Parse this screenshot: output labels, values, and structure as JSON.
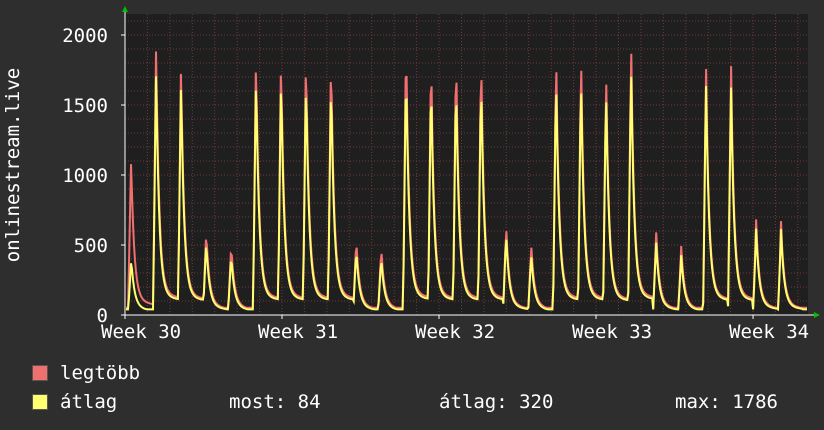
{
  "colors": {
    "background": "#2e2e2e",
    "plot_background": "#1f1f1f",
    "grid": "#6e3a3a",
    "text": "#ffffff",
    "axis": "#ffffff",
    "arrow": "#00c000",
    "max_color": "#f07070",
    "avg_color": "#ffff70"
  },
  "chart_data": {
    "type": "area",
    "ylabel": "onlinestream.live",
    "y_ticks": [
      "0",
      "500",
      "1000",
      "1500",
      "2000"
    ],
    "ylim": [
      0,
      2150
    ],
    "x_ticks": [
      "Week 30",
      "Week 31",
      "Week 32",
      "Week 33",
      "Week 34"
    ],
    "grid": true,
    "series": [
      {
        "name": "legtöbb",
        "color": "#f07070",
        "values": [
          1080,
          1910,
          1770,
          560,
          460,
          1850,
          1850,
          1860,
          1850,
          500,
          440,
          1960,
          1850,
          1860,
          1860,
          600,
          460,
          1860,
          1850,
          1720,
          1940,
          550,
          440,
          1760,
          1760,
          620,
          600
        ]
      },
      {
        "name": "átlag",
        "color": "#ffff70",
        "values": [
          370,
          1730,
          1650,
          500,
          400,
          1710,
          1710,
          1700,
          1690,
          440,
          380,
          1780,
          1700,
          1690,
          1700,
          550,
          400,
          1700,
          1690,
          1600,
          1780,
          490,
          390,
          1650,
          1620,
          570,
          560
        ]
      }
    ]
  },
  "legend": [
    {
      "label": "legtöbb",
      "color": "#f07070"
    },
    {
      "label": "átlag",
      "color": "#ffff70"
    }
  ],
  "stats": {
    "now": "most: 84",
    "avg": "átlag: 320",
    "max": "max: 1786"
  }
}
